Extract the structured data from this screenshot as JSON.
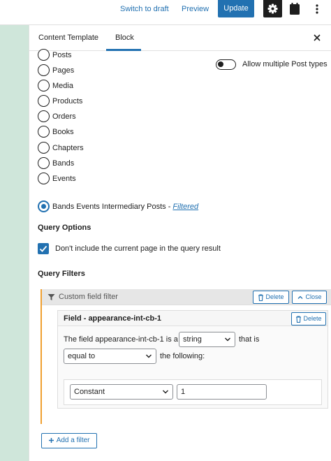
{
  "topbar": {
    "switch_draft": "Switch to draft",
    "preview": "Preview",
    "update": "Update",
    "icons": [
      "gear-icon",
      "calendar-icon",
      "more-vertical-icon"
    ]
  },
  "sidebar": {
    "tabs": [
      {
        "label": "Content Template",
        "active": false
      },
      {
        "label": "Block",
        "active": true
      }
    ],
    "post_types": [
      "Posts",
      "Pages",
      "Media",
      "Products",
      "Orders",
      "Books",
      "Chapters",
      "Bands",
      "Events"
    ],
    "toggle_label": "Allow multiple Post types",
    "toggle_on": false,
    "selected_type": "Bands Events Intermediary Posts",
    "selected_separator": " - ",
    "selected_link": "Filtered"
  },
  "query_options": {
    "title": "Query Options",
    "exclude_current_label": "Don't include the current page in the query result",
    "exclude_current_checked": true
  },
  "query_filters": {
    "title": "Query Filters",
    "filter": {
      "title": "Custom field filter",
      "delete_label": "Delete",
      "close_label": "Close",
      "field": {
        "title": "Field - appearance-int-cb-1",
        "delete_label": "Delete",
        "sentence_prefix": "The field appearance-int-cb-1 is a",
        "type_value": "string",
        "sentence_mid": "that is",
        "comparison_value": "equal to",
        "sentence_suffix": "the following:",
        "source_value": "Constant",
        "value": "1"
      }
    },
    "add_label": "Add a filter"
  },
  "colors": {
    "accent": "#2271b1",
    "left_strip": "#cfe6da",
    "filter_border": "#f0a030"
  }
}
